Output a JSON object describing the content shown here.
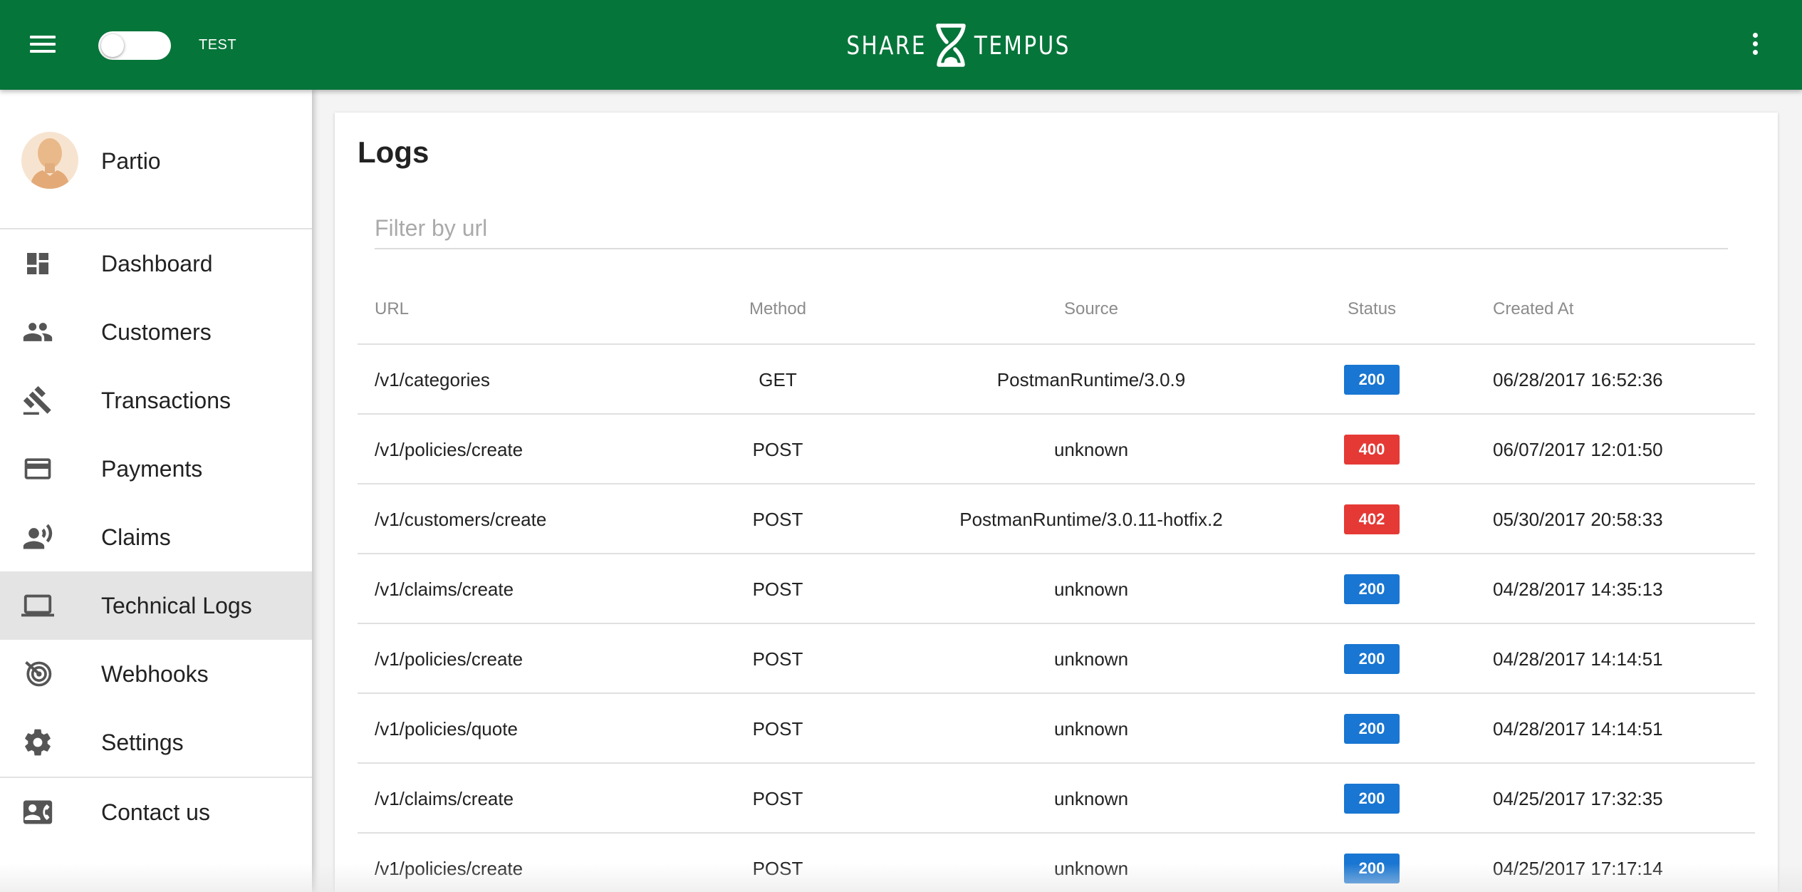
{
  "header": {
    "mode_label": "TEST",
    "mode_enabled": false,
    "logo_left": "SHARE",
    "logo_right": "TEMPUS",
    "brand_color": "#06753a"
  },
  "sidebar": {
    "user_name": "Partio",
    "items": [
      {
        "label": "Dashboard",
        "icon": "dashboard-icon"
      },
      {
        "label": "Customers",
        "icon": "people-icon"
      },
      {
        "label": "Transactions",
        "icon": "gavel-icon"
      },
      {
        "label": "Payments",
        "icon": "credit-card-icon"
      },
      {
        "label": "Claims",
        "icon": "record-voice-icon"
      },
      {
        "label": "Technical Logs",
        "icon": "laptop-icon",
        "active": true
      },
      {
        "label": "Webhooks",
        "icon": "webhook-icon"
      },
      {
        "label": "Settings",
        "icon": "gear-icon"
      },
      {
        "label": "Contact us",
        "icon": "contact-card-icon"
      }
    ]
  },
  "logs": {
    "title": "Logs",
    "filter_placeholder": "Filter by url",
    "filter_value": "",
    "columns": {
      "url": "URL",
      "method": "Method",
      "source": "Source",
      "status": "Status",
      "created": "Created At"
    },
    "status_colors": {
      "success": "#1976d2",
      "error": "#e53935"
    },
    "rows": [
      {
        "url": "/v1/categories",
        "method": "GET",
        "source": "PostmanRuntime/3.0.9",
        "status": "200",
        "created": "06/28/2017 16:52:36"
      },
      {
        "url": "/v1/policies/create",
        "method": "POST",
        "source": "unknown",
        "status": "400",
        "created": "06/07/2017 12:01:50"
      },
      {
        "url": "/v1/customers/create",
        "method": "POST",
        "source": "PostmanRuntime/3.0.11-hotfix.2",
        "status": "402",
        "created": "05/30/2017 20:58:33"
      },
      {
        "url": "/v1/claims/create",
        "method": "POST",
        "source": "unknown",
        "status": "200",
        "created": "04/28/2017 14:35:13"
      },
      {
        "url": "/v1/policies/create",
        "method": "POST",
        "source": "unknown",
        "status": "200",
        "created": "04/28/2017 14:14:51"
      },
      {
        "url": "/v1/policies/quote",
        "method": "POST",
        "source": "unknown",
        "status": "200",
        "created": "04/28/2017 14:14:51"
      },
      {
        "url": "/v1/claims/create",
        "method": "POST",
        "source": "unknown",
        "status": "200",
        "created": "04/25/2017 17:32:35"
      },
      {
        "url": "/v1/policies/create",
        "method": "POST",
        "source": "unknown",
        "status": "200",
        "created": "04/25/2017 17:17:14"
      }
    ]
  }
}
